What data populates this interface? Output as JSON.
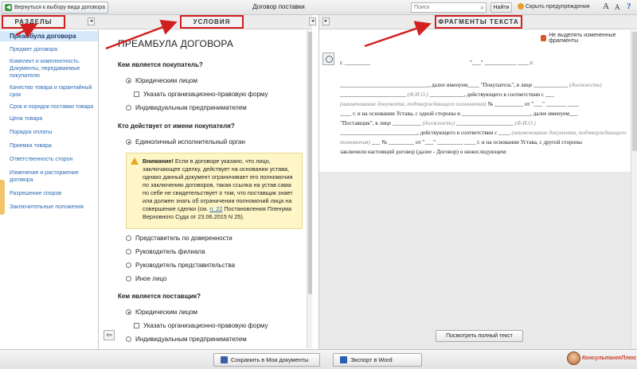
{
  "toolbar": {
    "back_label": "Вернуться к выбору вида договора",
    "doc_title": "Договор поставки",
    "search_placeholder": "Поиск",
    "find_label": "Найти",
    "hide_warnings_label": "Скрыть предупреждения",
    "font_larger": "A",
    "font_smaller": "A",
    "help": "?"
  },
  "sections": {
    "left": "РАЗДЕЛЫ",
    "middle": "УСЛОВИЯ",
    "right": "ФРАГМЕНТЫ ТЕКСТА"
  },
  "nav": {
    "items": [
      "Преамбула договора",
      "Предмет договора",
      "Комплект и комплектность. Документы, передаваемые покупателю",
      "Качество товара и гарантийный срок",
      "Срок и порядок поставки товара",
      "Цена товара",
      "Порядок оплаты",
      "Приемка товара",
      "Ответственность сторон",
      "Изменение и расторжение договора",
      "Разрешение споров",
      "Заключительные положения"
    ]
  },
  "conditions": {
    "title": "ПРЕАМБУЛА ДОГОВОРА",
    "q1": "Кем является покупатель?",
    "q1_opt1": "Юридическим лицом",
    "q1_opt1_sub": "Указать организационно-правовую форму",
    "q1_opt2": "Индивидуальным предпринимателем",
    "q2": "Кто действует от имени покупателя?",
    "q2_opt1": "Единоличный исполнительный орган",
    "warning": {
      "bold": "Внимание!",
      "text": " Если в договоре указано, что лицо, заключающее сделку, действует на основании устава, однако данный документ ограничивает его полномочия по заключению договоров, такая ссылка на устав сама по себе не свидетельствует о том, что поставщик знает или должен знать об ограничении полномочий лица на совершение сделки (см. ",
      "link": "п. 22",
      "tail": " Постановления Пленума Верховного Суда от 23.06.2015 N 25)."
    },
    "q2_opt2": "Представитель по доверенности",
    "q2_opt3": "Руководитель филиала",
    "q2_opt4": "Руководитель представительства",
    "q2_opt5": "Иное лицо",
    "q3": "Кем является поставщик?",
    "q3_opt1": "Юридическим лицом",
    "q3_opt1_sub": "Указать организационно-правовую форму",
    "q3_opt2": "Индивидуальным предпринимателем"
  },
  "fragments": {
    "no_highlight_label": "Не выделять измененные фрагменты",
    "lines": [
      {
        "a": "г. _________",
        "b": "\"___\" ___________ ____ г."
      },
      {
        "a": "_______________________________, далее именуем____ \"Покупатель\", в лице ____________",
        "g": "(должность)"
      },
      {
        "a": "_______________________",
        "g": "(Ф.И.О.)",
        "c": "____________, действующего в соответствии с ___"
      },
      {
        "g": "(наименование документа, подтверждающего полномочия)",
        "c": "№ __________ от \"___\" _______ ____"
      },
      {
        "a": "____ г. и на основании Устава, с одной стороны и ________________________, далее именуем___"
      },
      {
        "a": "\"Поставщик\", в лице __________",
        "g": "(должность)",
        "c": "____________________",
        "g2": "(Ф.И.О.)"
      },
      {
        "a": "___________________________, действующего в соответствии с ____",
        "g": "(наименование документа, подтверждающего"
      },
      {
        "g": "полномочия)",
        "c": "___ № _________ от \"___\" _________ ____ г. и на основании Устава, с другой стороны"
      },
      {
        "a": "заключили настоящий договор (далее - Договор) о нижеследующем:"
      }
    ],
    "full_text_button": "Посмотреть полный текст"
  },
  "bottom": {
    "save_label": "Сохранить в Мои документы",
    "export_label": "Экспорт в Word",
    "logo_text": "КонсультантПлюс"
  },
  "colors": {
    "accent_red": "#d21f1f",
    "nav_link": "#2b6cb6",
    "warning_bg": "#fff6c7"
  }
}
